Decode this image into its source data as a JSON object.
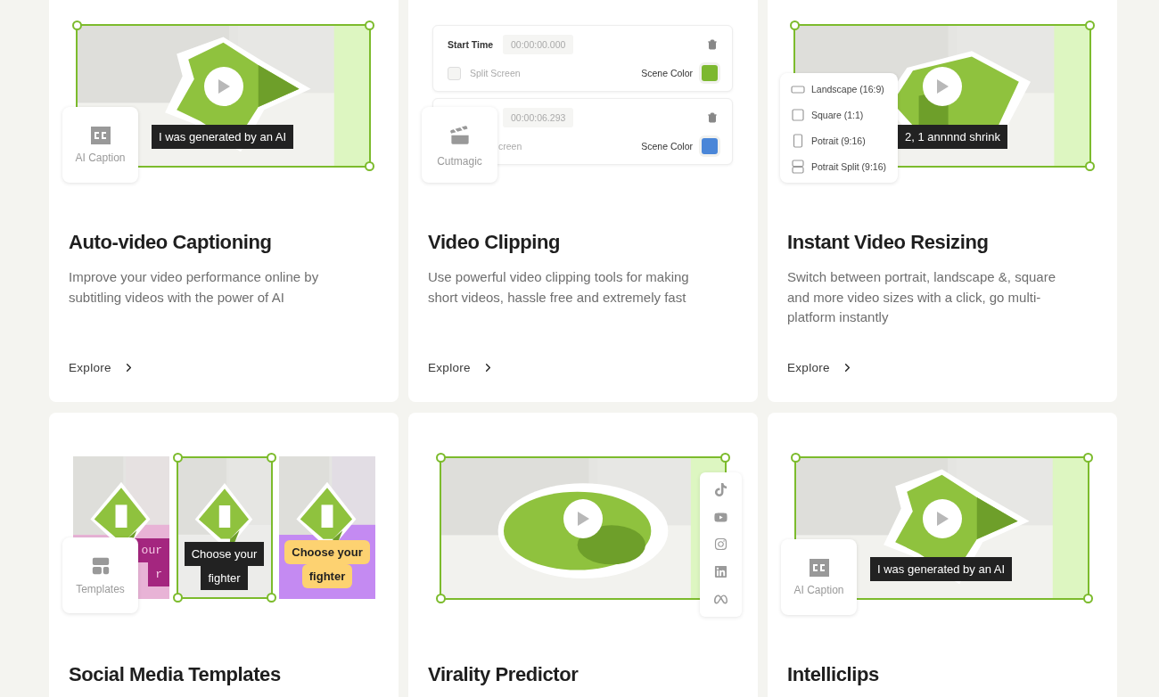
{
  "cards": [
    {
      "kind": "caption",
      "title": "Auto-video Captioning",
      "description": "Improve your video performance online by subtitling videos with the power of AI",
      "link": "Explore",
      "badge": "AI Caption",
      "caption": "I was generated by an AI"
    },
    {
      "kind": "clipping",
      "title": "Video Clipping",
      "description": "Use powerful video clipping tools for making short videos, hassle free and extremely fast",
      "link": "Explore",
      "badge": "Cutmagic",
      "clips": [
        {
          "label": "Start Time",
          "time": "00:00:00.000",
          "checkbox_label": "Split Screen",
          "checked": false,
          "color_label": "Scene Color",
          "color": "#7cb82f"
        },
        {
          "time": "00:00:06.293",
          "checkbox_label": "creen",
          "color_label": "Scene Color",
          "color": "#4a86d8"
        }
      ]
    },
    {
      "kind": "resize",
      "title": "Instant Video Resizing",
      "description": "Switch between portrait, landscape &, square and more video sizes with a click, go multi-platform instantly",
      "link": "Explore",
      "caption": "2, 1 annnnd shrink",
      "options": [
        {
          "label": "Landscape (16:9)",
          "kind": "landscape"
        },
        {
          "label": "Square (1:1)",
          "kind": "square"
        },
        {
          "label": "Potrait (9:16)",
          "kind": "portrait"
        },
        {
          "label": "Potrait Split (9:16)",
          "kind": "split"
        }
      ]
    },
    {
      "kind": "templates",
      "title": "Social Media Templates",
      "badge": "Templates",
      "panels": [
        {
          "kind": "mono",
          "lines": [
            "our",
            "r"
          ],
          "selected": false
        },
        {
          "kind": "dark",
          "lines": [
            "Choose your",
            "fighter"
          ],
          "selected": true
        },
        {
          "kind": "bold",
          "lines": [
            "Choose your",
            "fighter"
          ],
          "selected": false
        }
      ]
    },
    {
      "kind": "virality",
      "title": "Virality Predictor",
      "socials": [
        {
          "kind": "tiktok"
        },
        {
          "kind": "youtube"
        },
        {
          "kind": "instagram"
        },
        {
          "kind": "linkedin"
        },
        {
          "kind": "meta"
        }
      ]
    },
    {
      "kind": "caption",
      "title": "Intelliclips",
      "badge": "AI Caption",
      "caption": "I was generated by an AI"
    }
  ]
}
